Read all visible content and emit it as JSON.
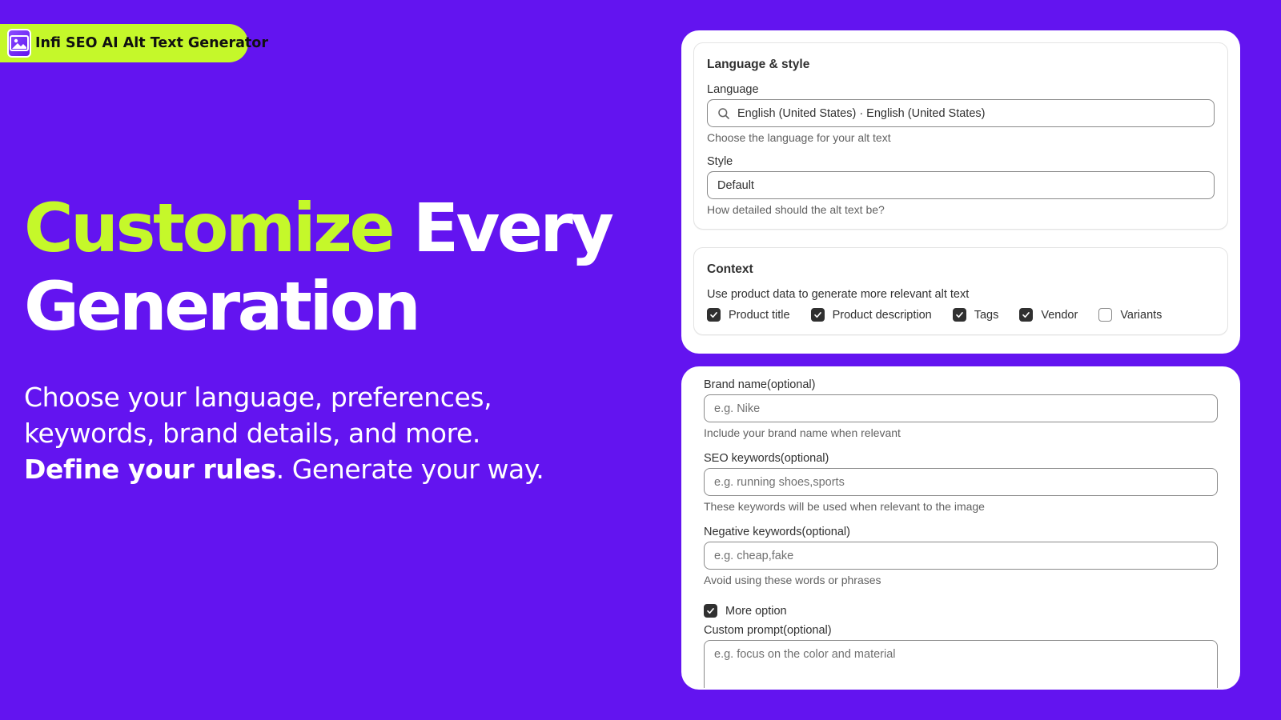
{
  "brand": {
    "name": "Infi SEO AI Alt Text Generator",
    "logo_icon": "image-ai-logo-icon",
    "pill_color": "#c5f82a"
  },
  "hero": {
    "title_accent": "Customize",
    "title_rest": "Every",
    "title_line2": "Generation",
    "body_line1": "Choose your language, preferences,",
    "body_line2": "keywords, brand details, and more.",
    "body_bold": "Define your rules",
    "body_tail": ". Generate your way."
  },
  "colors": {
    "background": "#6314f0",
    "accent": "#c5f82a",
    "panel": "#ffffff"
  },
  "language_style": {
    "title": "Language & style",
    "language_label": "Language",
    "language_value": "English (United States) · English (United States)",
    "language_icon": "search-icon",
    "language_help": "Choose the language for your alt text",
    "style_label": "Style",
    "style_value": "Default",
    "style_help": "How detailed should the alt text be?"
  },
  "context": {
    "title": "Context",
    "description": "Use product data to generate more relevant alt text",
    "options": [
      {
        "label": "Product title",
        "checked": true
      },
      {
        "label": "Product description",
        "checked": true
      },
      {
        "label": "Tags",
        "checked": true
      },
      {
        "label": "Vendor",
        "checked": true
      },
      {
        "label": "Variants",
        "checked": false
      }
    ]
  },
  "brand_settings": {
    "brand_name_label": "Brand name(optional)",
    "brand_name_placeholder": "e.g. Nike",
    "brand_name_help": "Include your brand name when relevant",
    "seo_keywords_label": "SEO keywords(optional)",
    "seo_keywords_placeholder": "e.g. running shoes,sports",
    "seo_keywords_help": "These keywords will be used when relevant to the image",
    "negative_keywords_label": "Negative keywords(optional)",
    "negative_keywords_placeholder": "e.g. cheap,fake",
    "negative_keywords_help": "Avoid using these words or phrases",
    "more_option_label": "More option",
    "more_option_checked": true,
    "custom_prompt_label": "Custom prompt(optional)",
    "custom_prompt_placeholder": "e.g. focus on the color and material"
  }
}
